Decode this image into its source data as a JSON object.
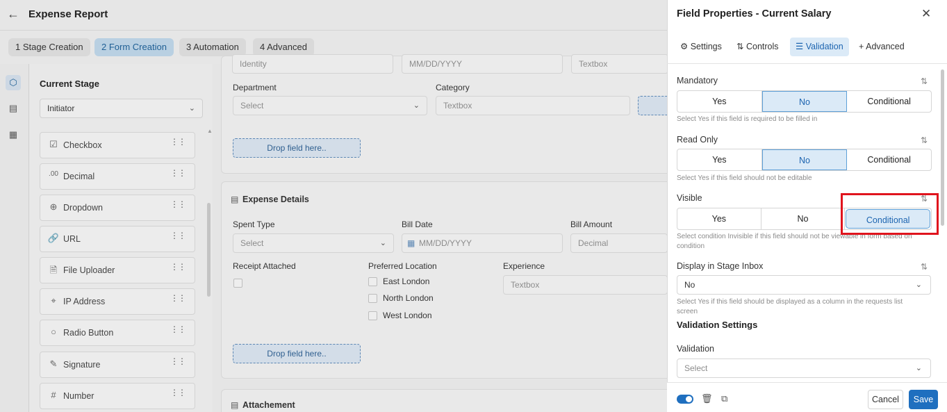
{
  "app": {
    "title": "Expense Report"
  },
  "steps": [
    {
      "label": "1  Stage Creation"
    },
    {
      "label": "2  Form Creation"
    },
    {
      "label": "3  Automation"
    },
    {
      "label": "4  Advanced"
    }
  ],
  "left_panel": {
    "stage_heading": "Current Stage",
    "stage_value": "Initiator",
    "controls": [
      {
        "label": "Checkbox",
        "icon": "checkbox-icon"
      },
      {
        "label": "Decimal",
        "icon": "decimal-icon"
      },
      {
        "label": "Dropdown",
        "icon": "dropdown-icon"
      },
      {
        "label": "URL",
        "icon": "link-icon"
      },
      {
        "label": "File Uploader",
        "icon": "file-upload-icon"
      },
      {
        "label": "IP Address",
        "icon": "ip-icon"
      },
      {
        "label": "Radio Button",
        "icon": "radio-icon"
      },
      {
        "label": "Signature",
        "icon": "signature-icon"
      },
      {
        "label": "Number",
        "icon": "hash-icon"
      }
    ]
  },
  "canvas": {
    "top_partial": {
      "identity": "Identity",
      "date": "MM/DD/YYYY",
      "textbox": "Textbox"
    },
    "department": {
      "label": "Department",
      "placeholder": "Select"
    },
    "category": {
      "label": "Category",
      "placeholder": "Textbox"
    },
    "drop_here": "Drop field here..",
    "expense_section": "Expense Details",
    "spent_type": {
      "label": "Spent Type",
      "placeholder": "Select"
    },
    "bill_date": {
      "label": "Bill Date",
      "placeholder": "MM/DD/YYYY"
    },
    "bill_amount": {
      "label": "Bill Amount",
      "placeholder": "Decimal"
    },
    "receipt": {
      "label": "Receipt Attached"
    },
    "preferred": {
      "label": "Preferred Location",
      "options": [
        "East London",
        "North London",
        "West London"
      ]
    },
    "experience": {
      "label": "Experience",
      "placeholder": "Textbox"
    },
    "attachment_section": "Attachement"
  },
  "panel": {
    "title": "Field Properties - Current Salary",
    "tabs": [
      "Settings",
      "Controls",
      "Validation",
      "Advanced"
    ],
    "mandatory": {
      "label": "Mandatory",
      "options": [
        "Yes",
        "No",
        "Conditional"
      ],
      "selected": "No",
      "hint": "Select Yes if this field is required to be filled in"
    },
    "read_only": {
      "label": "Read Only",
      "options": [
        "Yes",
        "No",
        "Conditional"
      ],
      "selected": "No",
      "hint": "Select Yes if this field should not be editable"
    },
    "visible": {
      "label": "Visible",
      "options": [
        "Yes",
        "No",
        "Conditional"
      ],
      "selected": "Conditional",
      "hint": "Select condition Invisible if this field should not be viewable in form based on condition"
    },
    "stage_inbox": {
      "label": "Display in Stage Inbox",
      "value": "No",
      "hint": "Select Yes if this field should be displayed as a column in the requests list screen"
    },
    "validation_settings": "Validation Settings",
    "validation": {
      "label": "Validation",
      "placeholder": "Select"
    },
    "cancel": "Cancel",
    "save": "Save"
  },
  "colors": {
    "accent": "#1f6fbf",
    "highlight": "#e0141d",
    "selected_bg": "#dbeaf7"
  }
}
